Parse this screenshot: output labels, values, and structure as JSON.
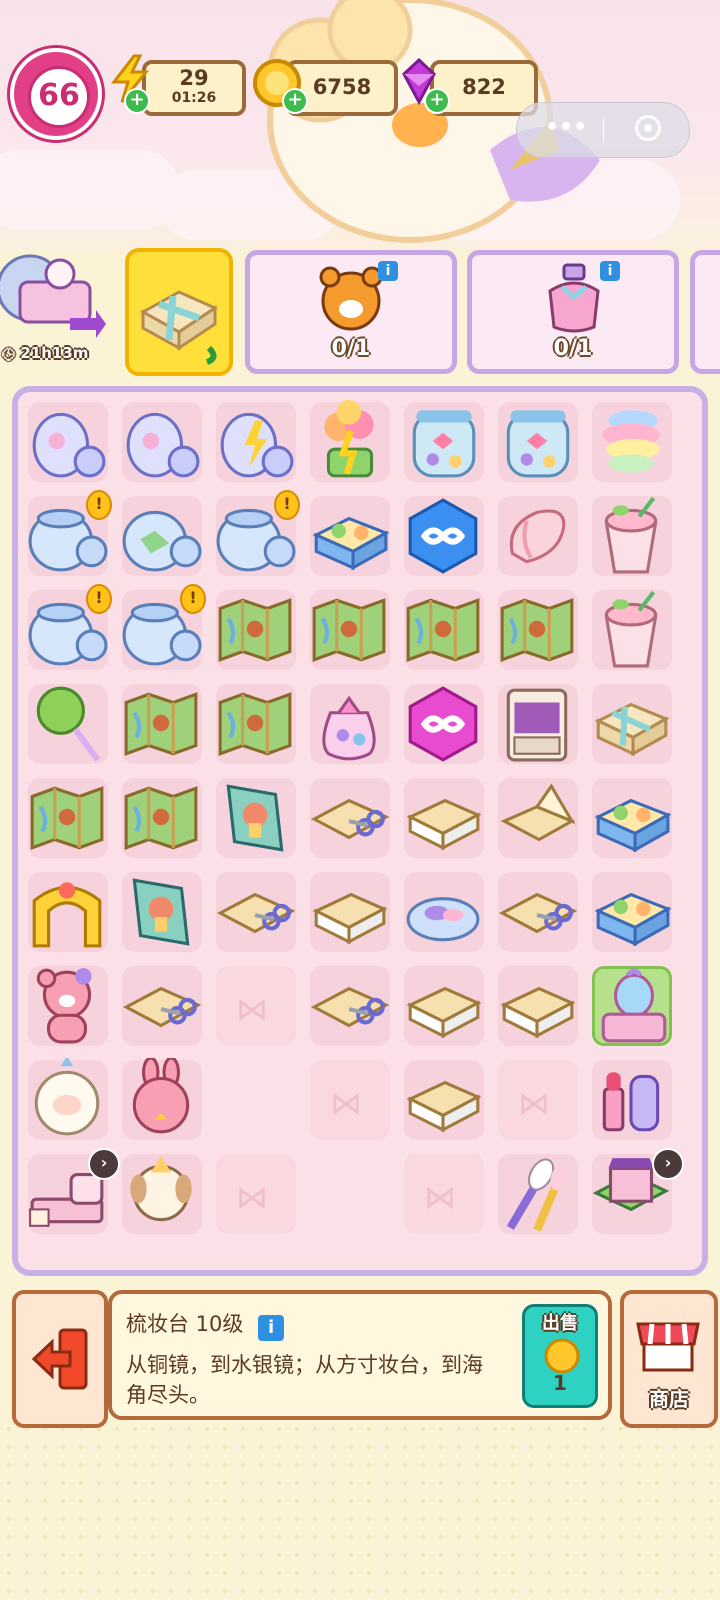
{
  "player": {
    "level": "66"
  },
  "resources": {
    "energy": {
      "value": "29",
      "timer": "01:26"
    },
    "coins": {
      "value": "6758"
    },
    "gems": {
      "value": "822"
    }
  },
  "event": {
    "timer": "21h13m"
  },
  "orders": [
    {
      "item": "teddy-figure",
      "progress": "0/1"
    },
    {
      "item": "perfume-bottle",
      "progress": "0/1"
    }
  ],
  "board": {
    "rows": [
      [
        "candy-jar-lid",
        "candy-jar-lid",
        "candy-jar-lid-sparkle",
        "balloon-cupcake-sparkle",
        "ribbon-candy-jar",
        "ribbon-candy-jar",
        "cotton-candy"
      ],
      [
        "glass-jar-alert",
        "mint-jar",
        "glass-jar-alert",
        "candy-box",
        "infinity-blue",
        "marshmallow",
        "milk-tea-cup"
      ],
      [
        "glass-jar-alert",
        "glass-jar-alert",
        "map",
        "map",
        "map",
        "map",
        "milk-tea-cup"
      ],
      [
        "lollipop",
        "map",
        "map",
        "candy-bag",
        "infinity-pink",
        "wardrobe",
        "gift-box"
      ],
      [
        "map",
        "map",
        "picture-book",
        "paper-scissors",
        "paper-stack",
        "paper-folder",
        "candy-box"
      ],
      [
        "golden-gate",
        "picture-book",
        "paper-scissors",
        "paper-stack",
        "candy-plate",
        "paper-scissors",
        "candy-box"
      ],
      [
        "bear-plush",
        "paper-scissors",
        "empty",
        "paper-scissors",
        "paper-stack",
        "paper-stack",
        "dressing-table"
      ],
      [
        "sheep-plush",
        "bunny-plush",
        "blank",
        "empty",
        "paper-stack",
        "empty",
        "lipstick-set"
      ],
      [
        "bed-set",
        "puppy-plush",
        "empty",
        "blank",
        "empty",
        "makeup-brushes",
        "shop-building"
      ]
    ]
  },
  "selected": {
    "title": "梳妆台 10级",
    "description": "从铜镜，到水银镜；从方寸妆台，到海角尽头。",
    "sell_label": "出售",
    "sell_price": "1"
  },
  "shop_label": "商店",
  "colors": {
    "accent": "#e23f86",
    "board_border": "#c8b0e6",
    "panel_border": "#b56a3b"
  }
}
